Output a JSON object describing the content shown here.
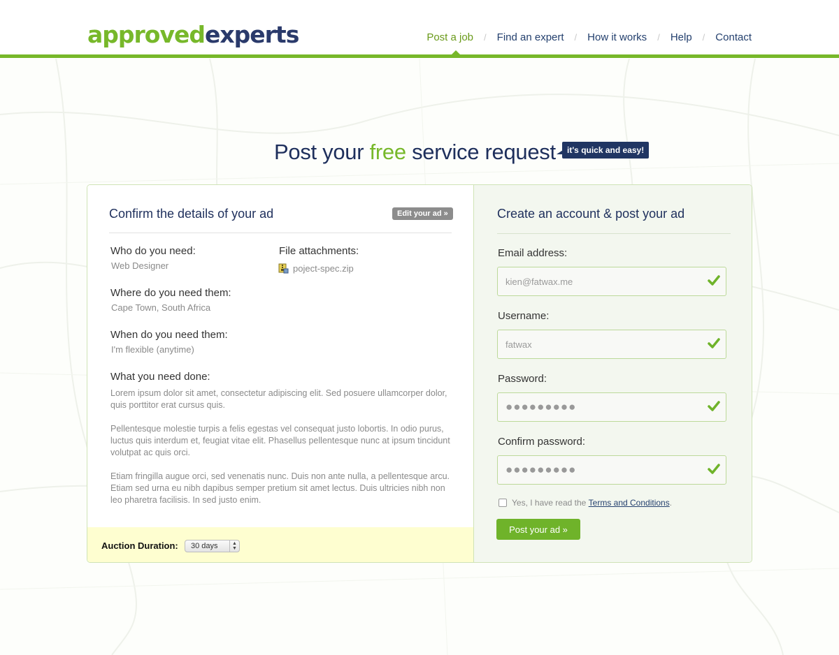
{
  "brand": {
    "logo_part1": "approved",
    "logo_part2": "experts",
    "accent_color": "#77b82a",
    "navy_color": "#1e2f5c"
  },
  "nav": {
    "items": [
      {
        "label": "Post a job",
        "active": true
      },
      {
        "label": "Find an expert",
        "active": false
      },
      {
        "label": "How it works",
        "active": false
      },
      {
        "label": "Help",
        "active": false
      },
      {
        "label": "Contact",
        "active": false
      }
    ],
    "separator": "/"
  },
  "heading": {
    "pre": "Post your ",
    "highlight": "free",
    "post": " service request",
    "tag": "it's quick and easy!"
  },
  "details": {
    "title": "Confirm the details of your ad",
    "edit_button": "Edit your ad »",
    "who_label": "Who do you need:",
    "who_value": "Web Designer",
    "files_label": "File attachments:",
    "file_name": "poject-spec.zip",
    "where_label": "Where do you need them:",
    "where_value": "Cape Town, South Africa",
    "when_label": "When do you need them:",
    "when_value": "I'm flexible (anytime)",
    "what_label": "What you need done:",
    "what_paragraphs": [
      "Lorem ipsum dolor sit amet, consectetur adipiscing elit. Sed posuere ullamcorper dolor, quis porttitor erat cursus quis.",
      "Pellentesque molestie turpis a felis egestas vel consequat justo lobortis. In odio purus, luctus quis interdum et, feugiat vitae elit. Phasellus pellentesque nunc at ipsum tincidunt volutpat ac quis orci.",
      "Etiam fringilla augue orci, sed venenatis nunc. Duis non ante nulla, a pellentesque arcu. Etiam sed urna eu nibh dapibus semper pretium sit amet lectus. Duis ultricies nibh non leo pharetra facilisis. In sed justo enim."
    ],
    "auction_label": "Auction Duration:",
    "auction_value": "30 days"
  },
  "account": {
    "title": "Create an account & post your ad",
    "email_label": "Email address:",
    "email_value": "kien@fatwax.me",
    "username_label": "Username:",
    "username_value": "fatwax",
    "password_label": "Password:",
    "password_value": "●●●●●●●●●",
    "confirm_label": "Confirm password:",
    "confirm_value": "●●●●●●●●●",
    "terms_text": "Yes, I have read the ",
    "terms_link": "Terms and Conditions",
    "terms_suffix": ".",
    "terms_checked": false,
    "submit_button": "Post your ad »"
  }
}
